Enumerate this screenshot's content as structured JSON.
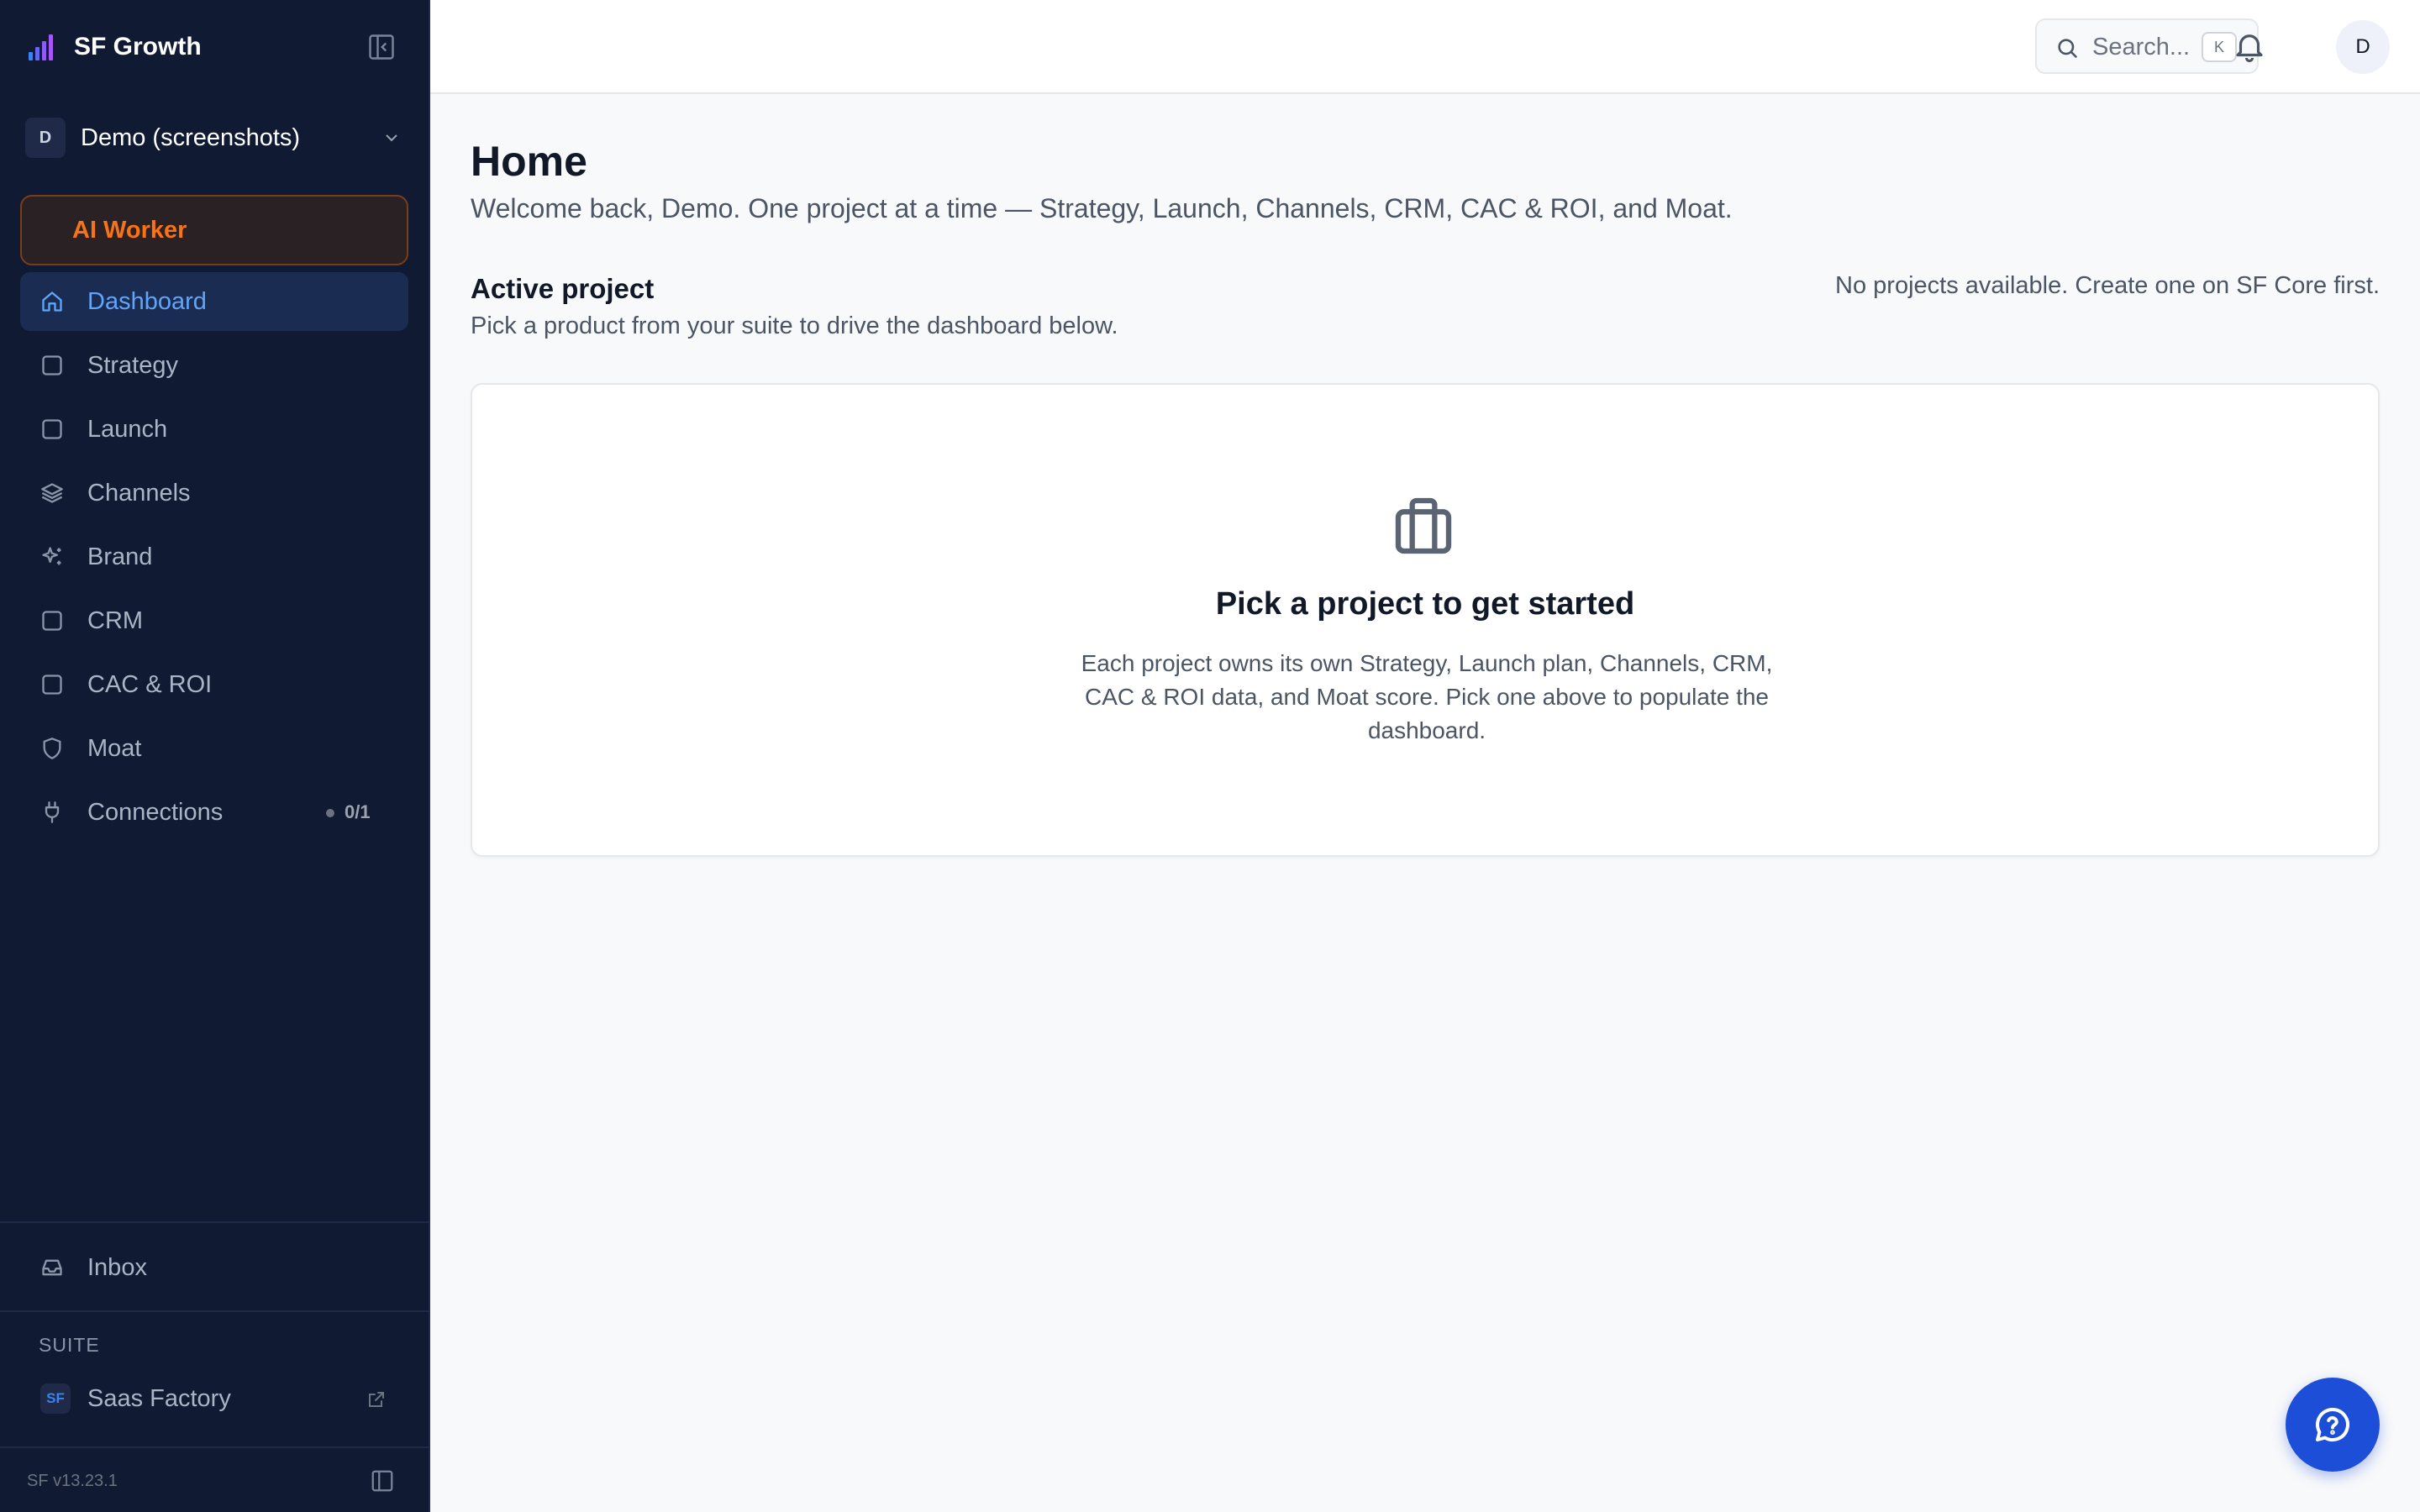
{
  "app": {
    "name": "SF Growth",
    "version": "SF v13.23.1"
  },
  "org": {
    "initial": "D",
    "name": "Demo (screenshots)"
  },
  "sidebar": {
    "ai_worker": "AI Worker",
    "items": [
      {
        "label": "Dashboard",
        "icon": "home-icon",
        "active": true
      },
      {
        "label": "Strategy",
        "icon": "square-icon"
      },
      {
        "label": "Launch",
        "icon": "square-icon"
      },
      {
        "label": "Channels",
        "icon": "layers-icon"
      },
      {
        "label": "Brand",
        "icon": "sparkles-icon"
      },
      {
        "label": "CRM",
        "icon": "square-icon"
      },
      {
        "label": "CAC & ROI",
        "icon": "square-icon"
      },
      {
        "label": "Moat",
        "icon": "shield-icon"
      },
      {
        "label": "Connections",
        "icon": "plug-icon",
        "badge": "0/1"
      }
    ],
    "inbox": "Inbox",
    "suite_label": "SUITE",
    "suite_items": [
      {
        "logo": "SF",
        "label": "Saas Factory",
        "icon": "external-link-icon"
      }
    ]
  },
  "topbar": {
    "search_placeholder": "Search...",
    "search_shortcut": "K",
    "avatar_initial": "D"
  },
  "main": {
    "title": "Home",
    "subtitle": "Welcome back, Demo. One project at a time — Strategy, Launch, Channels, CRM, CAC & ROI, and Moat.",
    "active_project": {
      "title": "Active project",
      "description": "Pick a product from your suite to drive the dashboard below.",
      "status": "No projects available. Create one on SF Core first."
    },
    "empty_state": {
      "icon": "briefcase-icon",
      "title": "Pick a project to get started",
      "body": "Each project owns its own Strategy, Launch plan, Channels, CRM, CAC & ROI data, and Moat score. Pick one above to populate the dashboard."
    }
  },
  "colors": {
    "sidebar_bg": "#101a33",
    "accent": "#60a5fa",
    "ai_worker": "#f97316",
    "help_button": "#1d4ed8"
  }
}
